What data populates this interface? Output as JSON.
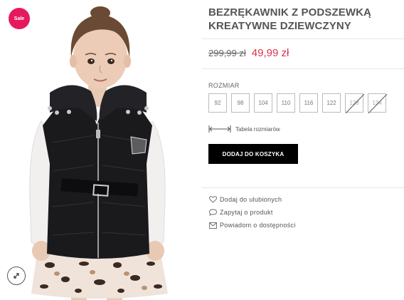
{
  "badge": {
    "label": "Sale"
  },
  "product": {
    "title": "BEZRĘKAWNIK Z PODSZEWKĄ KREATYWNE DZIEWCZYNY",
    "old_price": "299,99 zł",
    "new_price": "49,99 zł"
  },
  "sizes": {
    "label": "ROZMIAR",
    "options": [
      {
        "label": "92",
        "available": true
      },
      {
        "label": "98",
        "available": true
      },
      {
        "label": "104",
        "available": true
      },
      {
        "label": "110",
        "available": true
      },
      {
        "label": "116",
        "available": true
      },
      {
        "label": "122",
        "available": true
      },
      {
        "label": "128",
        "available": false
      },
      {
        "label": "134",
        "available": false
      }
    ],
    "table_link": "Tabela rozmiarów"
  },
  "cart": {
    "label": "DODAJ DO KOSZYKA"
  },
  "actions": {
    "wishlist": "Dodaj do ulubionych",
    "ask": "Zapytaj o produkt",
    "notify": "Powiadom o dostępności"
  },
  "colors": {
    "sale_badge": "#e6195d",
    "price_new": "#d9334a",
    "button_bg": "#000000"
  },
  "icons": {
    "zoom": "expand-icon",
    "ruler": "ruler-icon",
    "heart": "heart-icon",
    "chat": "chat-bubble-icon",
    "mail": "envelope-icon"
  }
}
